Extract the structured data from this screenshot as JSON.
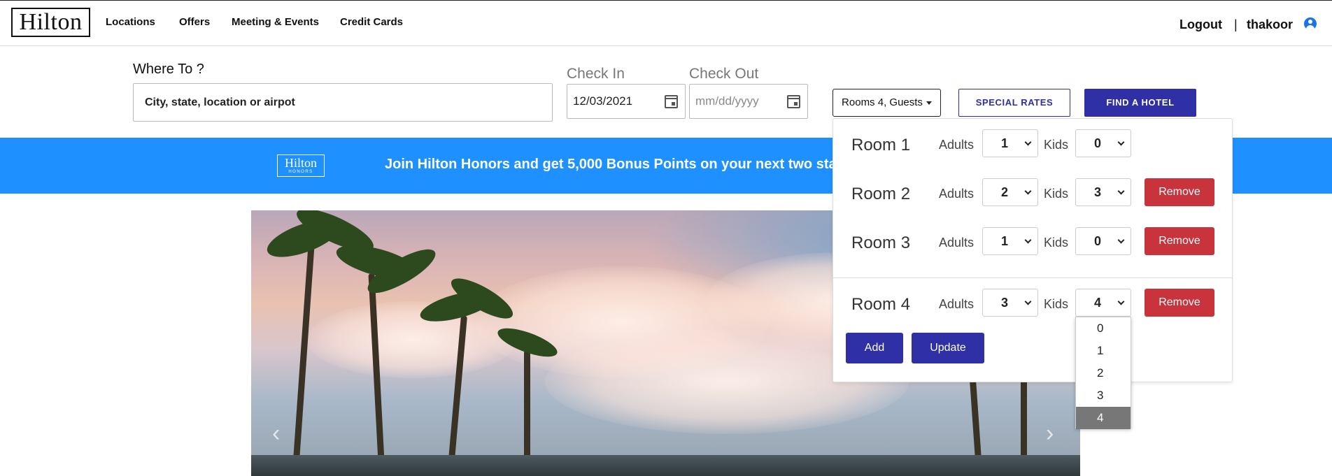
{
  "brand": {
    "logo_text": "Hilton",
    "honors_logo_line1": "Hilton",
    "honors_logo_line2": "HONORS"
  },
  "nav": {
    "links": [
      "Locations",
      "Offers",
      "Meeting & Events",
      "Credit Cards"
    ],
    "logout": "Logout",
    "separator": "|",
    "username": "thakoor",
    "user_icon": "user-circle-icon"
  },
  "search": {
    "where_label": "Where To ?",
    "where_placeholder": "City, state, location or airpot",
    "checkin_label": "Check In",
    "checkin_value": "12/03/2021",
    "checkout_label": "Check Out",
    "checkout_placeholder": "mm/dd/yyyy",
    "rooms_button": "Rooms 4, Guests",
    "special_rates": "SPECIAL RATES",
    "find_hotel": "FIND A HOTEL"
  },
  "banner": {
    "text": "Join Hilton Honors and get 5,000 Bonus Points on your next two stays.",
    "color": "#1e90ff"
  },
  "rooms_panel": {
    "adults_label": "Adults",
    "kids_label": "Kids",
    "remove_label": "Remove",
    "rooms": [
      {
        "title": "Room 1",
        "adults": "1",
        "kids": "0"
      },
      {
        "title": "Room 2",
        "adults": "2",
        "kids": "3"
      },
      {
        "title": "Room 3",
        "adults": "1",
        "kids": "0"
      },
      {
        "title": "Room 4",
        "adults": "3",
        "kids": "4"
      }
    ],
    "add_label": "Add",
    "update_label": "Update"
  },
  "kids_dropdown": {
    "options": [
      "0",
      "1",
      "2",
      "3",
      "4"
    ],
    "selected": "4"
  },
  "carousel": {
    "prev_glyph": "‹",
    "next_glyph": "›"
  },
  "colors": {
    "primary": "#2f2fa6",
    "danger": "#c9343c",
    "banner": "#1e90ff",
    "user_icon": "#1a73e8"
  }
}
